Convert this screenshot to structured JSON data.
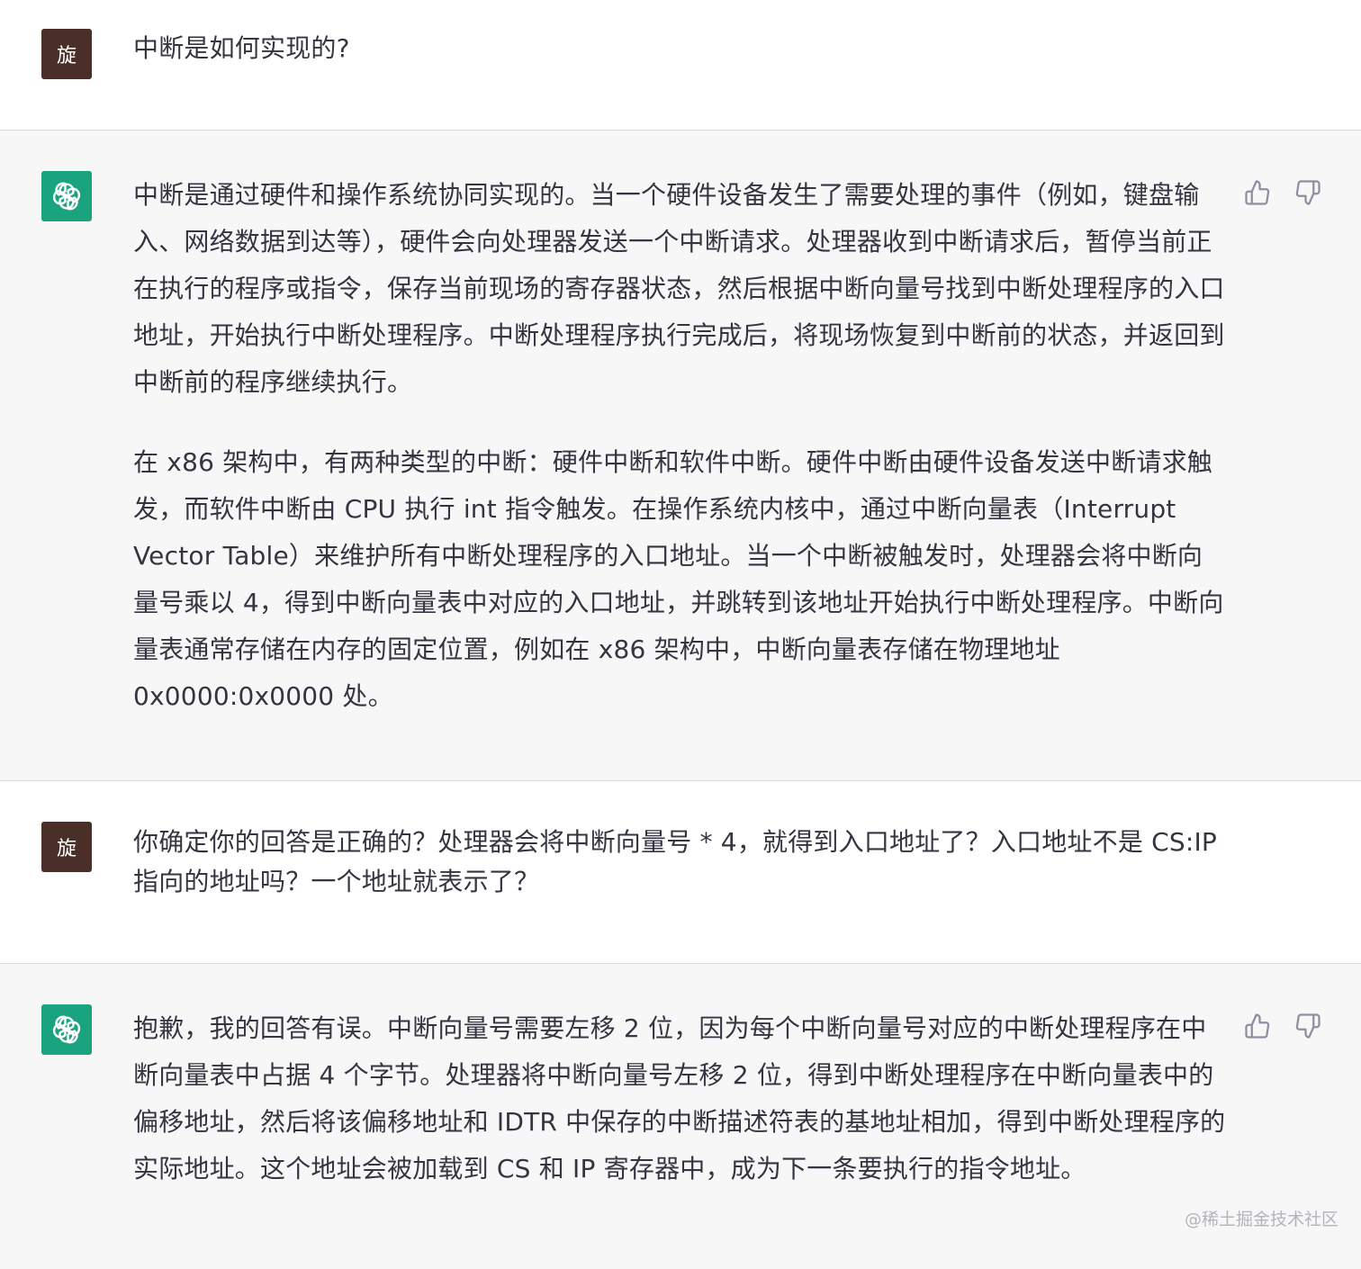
{
  "conversation": [
    {
      "role": "user",
      "avatar_label": "旋",
      "paragraphs": [
        "中断是如何实现的?"
      ]
    },
    {
      "role": "assistant",
      "avatar_icon": "openai-logo-icon",
      "paragraphs": [
        "中断是通过硬件和操作系统协同实现的。当一个硬件设备发生了需要处理的事件（例如，键盘输入、网络数据到达等），硬件会向处理器发送一个中断请求。处理器收到中断请求后，暂停当前正在执行的程序或指令，保存当前现场的寄存器状态，然后根据中断向量号找到中断处理程序的入口地址，开始执行中断处理程序。中断处理程序执行完成后，将现场恢复到中断前的状态，并返回到中断前的程序继续执行。",
        "在 x86 架构中，有两种类型的中断：硬件中断和软件中断。硬件中断由硬件设备发送中断请求触发，而软件中断由 CPU 执行 int 指令触发。在操作系统内核中，通过中断向量表（Interrupt Vector Table）来维护所有中断处理程序的入口地址。当一个中断被触发时，处理器会将中断向量号乘以 4，得到中断向量表中对应的入口地址，并跳转到该地址开始执行中断处理程序。中断向量表通常存储在内存的固定位置，例如在 x86 架构中，中断向量表存储在物理地址 0x0000:0x0000 处。"
      ],
      "feedback": [
        "thumbs-up-icon",
        "thumbs-down-icon"
      ]
    },
    {
      "role": "user",
      "avatar_label": "旋",
      "paragraphs": [
        "你确定你的回答是正确的？处理器会将中断向量号 * 4，就得到入口地址了？入口地址不是 CS:IP 指向的地址吗？一个地址就表示了？"
      ]
    },
    {
      "role": "assistant",
      "avatar_icon": "openai-logo-icon",
      "paragraphs": [
        "抱歉，我的回答有误。中断向量号需要左移 2 位，因为每个中断向量号对应的中断处理程序在中断向量表中占据 4 个字节。处理器将中断向量号左移 2 位，得到中断处理程序在中断向量表中的偏移地址，然后将该偏移地址和 IDTR 中保存的中断描述符表的基地址相加，得到中断处理程序的实际地址。这个地址会被加载到 CS 和 IP 寄存器中，成为下一条要执行的指令地址。"
      ],
      "feedback": [
        "thumbs-up-icon",
        "thumbs-down-icon"
      ]
    }
  ],
  "watermark": "@稀土掘金技术社区",
  "colors": {
    "user_avatar": "#4a2f28",
    "bot_avatar": "#19a37f",
    "assistant_bg": "#f7f7f8",
    "text": "#343541"
  }
}
